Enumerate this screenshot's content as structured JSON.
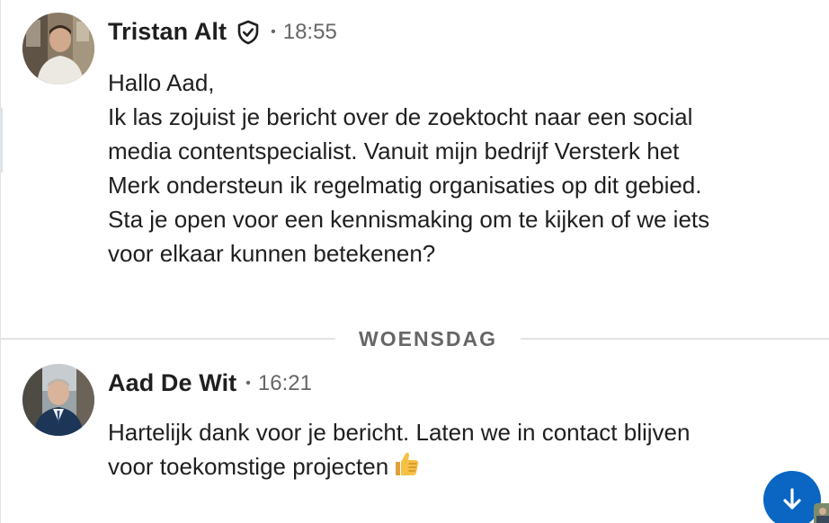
{
  "messages": [
    {
      "sender": "Tristan Alt",
      "verified": true,
      "separator": "•",
      "time": "18:55",
      "lines": [
        "Hallo Aad,",
        "Ik las zojuist je bericht over de zoektocht naar een social media contentspecialist. Vanuit mijn bedrijf Versterk het Merk ondersteun ik regelmatig organisaties op dit gebied. Sta je open voor een kennismaking om te kijken of we iets voor elkaar kunnen betekenen?"
      ],
      "avatar_icon": "avatar-photo"
    },
    {
      "sender": "Aad De Wit",
      "verified": false,
      "separator": "•",
      "time": "16:21",
      "text": "Hartelijk dank voor je bericht. Laten we in contact blijven voor toekomstige projecten",
      "emoji": "thumbs-up-icon",
      "avatar_icon": "avatar-photo"
    }
  ],
  "date_divider": {
    "label": "WOENSDAG"
  },
  "controls": {
    "scroll_down_icon": "arrow-down-icon"
  },
  "colors": {
    "accent": "#0a66c2",
    "text_primary": "#1f1f1f",
    "text_secondary": "#666666",
    "divider": "#e3e3e3"
  }
}
